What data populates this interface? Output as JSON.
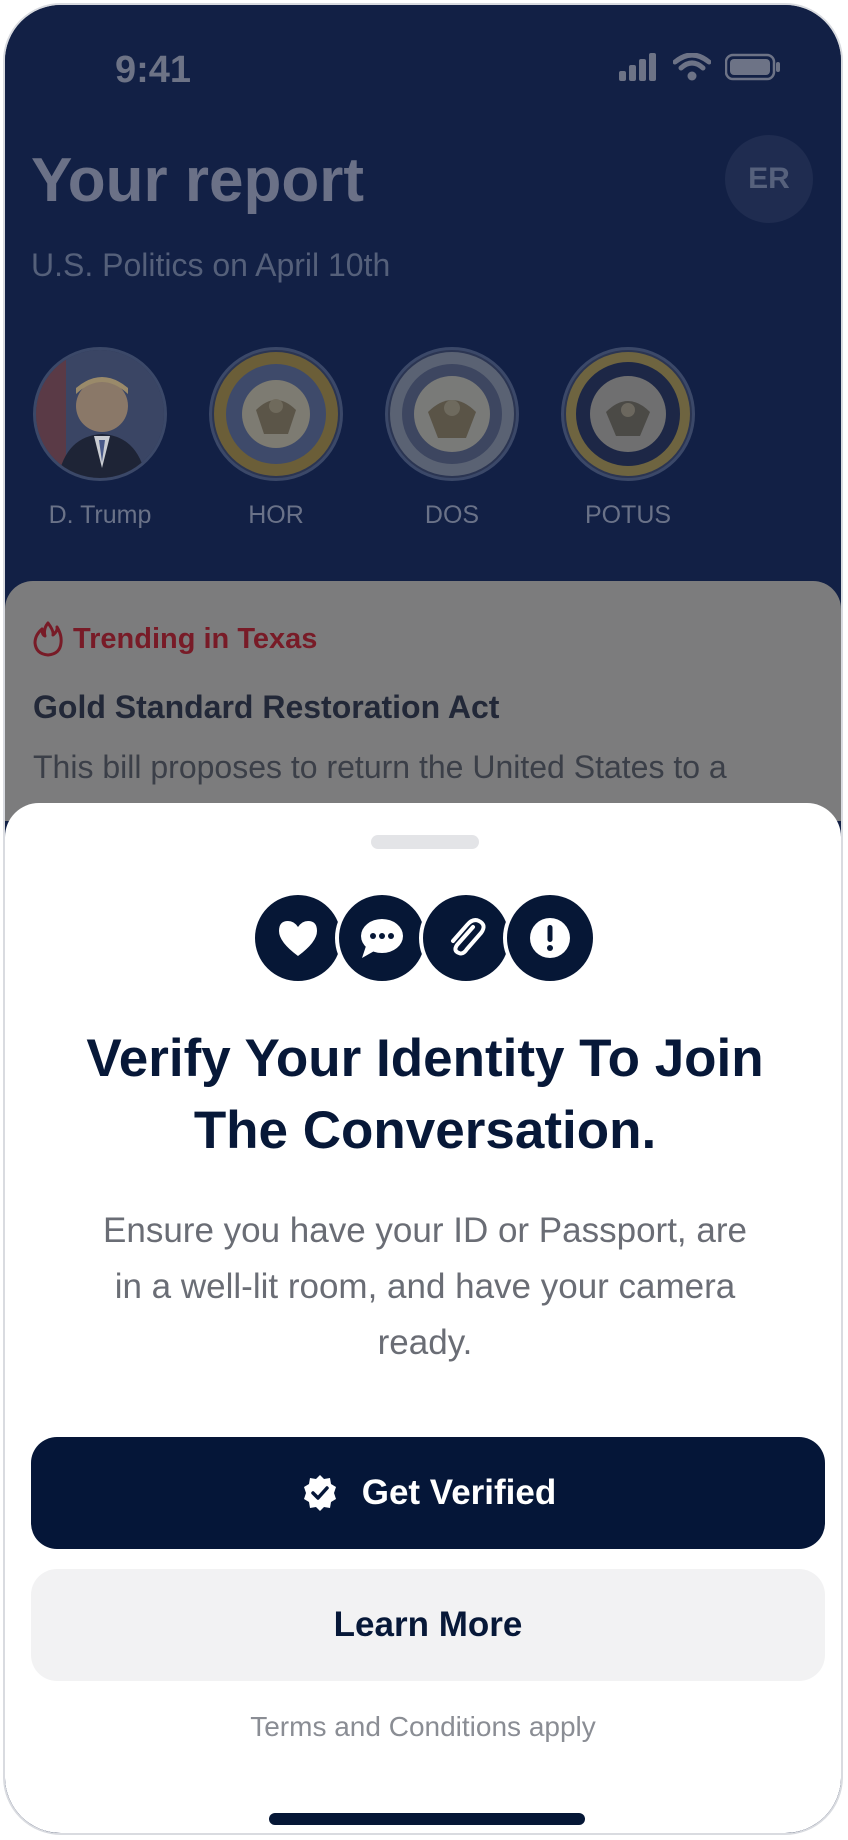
{
  "status_bar": {
    "time": "9:41",
    "icons": [
      "signal-icon",
      "wifi-icon",
      "battery-icon"
    ]
  },
  "header": {
    "title": "Your report",
    "subtitle": "U.S. Politics on April 10th",
    "avatar_initials": "ER"
  },
  "entities": [
    {
      "label": "D. Trump",
      "icon": "portrait-image"
    },
    {
      "label": "HOR",
      "icon": "house-seal-image"
    },
    {
      "label": "DOS",
      "icon": "state-dept-seal-image"
    },
    {
      "label": "POTUS",
      "icon": "presidential-seal-image"
    }
  ],
  "card": {
    "trending": "Trending in Texas",
    "title": "Gold Standard Restoration Act",
    "body": "This bill proposes to return the United States to a"
  },
  "sheet": {
    "feature_icons": [
      "heart-icon",
      "comment-icon",
      "paperclip-icon",
      "alert-icon"
    ],
    "title": "Verify Your Identity To Join The Conversation.",
    "description": "Ensure you have your ID or Passport, are in a well-lit room, and have your camera ready.",
    "primary_button": "Get Verified",
    "secondary_button": "Learn More",
    "terms": "Terms and Conditions apply"
  },
  "colors": {
    "navy": "#051638",
    "trending_red": "#781b27",
    "overlay_bg": "#122045"
  }
}
